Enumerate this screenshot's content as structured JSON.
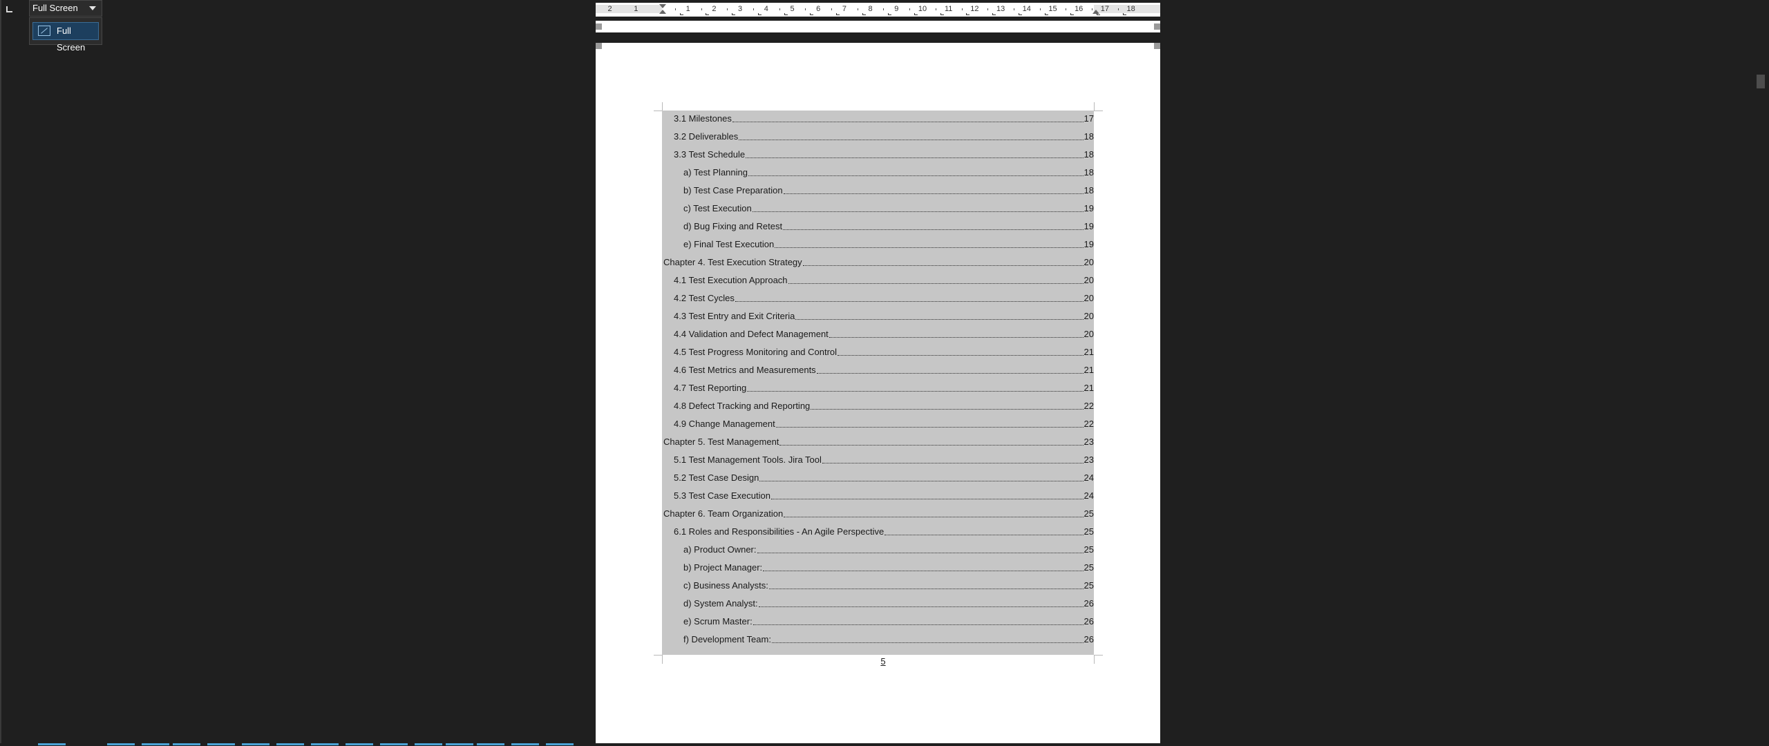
{
  "view_mode": {
    "selected": "Full Screen",
    "menu_items": [
      "Full Screen"
    ]
  },
  "ruler": {
    "left_labels": [
      "2",
      "1"
    ],
    "labels": [
      "1",
      "2",
      "3",
      "4",
      "5",
      "6",
      "7",
      "8",
      "9",
      "10",
      "11",
      "12",
      "13",
      "14",
      "15",
      "16",
      "17",
      "18"
    ]
  },
  "toc": {
    "entries": [
      {
        "text": "3.1 Milestones",
        "page": "17",
        "level": 1
      },
      {
        "text": "3.2 Deliverables",
        "page": "18",
        "level": 1
      },
      {
        "text": "3.3 Test Schedule",
        "page": "18",
        "level": 1
      },
      {
        "text": "a) Test Planning",
        "page": "18",
        "level": 2
      },
      {
        "text": "b) Test Case Preparation",
        "page": "18",
        "level": 2
      },
      {
        "text": "c) Test Execution",
        "page": "19",
        "level": 2
      },
      {
        "text": "d) Bug Fixing and Retest",
        "page": "19",
        "level": 2
      },
      {
        "text": "e) Final Test Execution",
        "page": "19",
        "level": 2
      },
      {
        "text": "Chapter 4. Test Execution Strategy",
        "page": "20",
        "level": 0
      },
      {
        "text": "4.1 Test Execution Approach",
        "page": "20",
        "level": 1
      },
      {
        "text": "4.2 Test Cycles",
        "page": "20",
        "level": 1
      },
      {
        "text": "4.3 Test Entry and Exit Criteria",
        "page": "20",
        "level": 1
      },
      {
        "text": "4.4 Validation and Defect Management",
        "page": "20",
        "level": 1
      },
      {
        "text": "4.5 Test Progress Monitoring and Control",
        "page": "21",
        "level": 1
      },
      {
        "text": "4.6 Test Metrics and Measurements",
        "page": "21",
        "level": 1
      },
      {
        "text": "4.7 Test Reporting",
        "page": "21",
        "level": 1
      },
      {
        "text": "4.8 Defect Tracking and Reporting",
        "page": "22",
        "level": 1
      },
      {
        "text": "4.9 Change Management",
        "page": "22",
        "level": 1
      },
      {
        "text": "Chapter 5. Test Management",
        "page": "23",
        "level": 0
      },
      {
        "text": "5.1 Test Management Tools. Jira Tool",
        "page": "23",
        "level": 1
      },
      {
        "text": "5.2 Test Case Design",
        "page": "24",
        "level": 1
      },
      {
        "text": "5.3 Test Case Execution",
        "page": "24",
        "level": 1
      },
      {
        "text": "Chapter 6. Team Organization",
        "page": "25",
        "level": 0
      },
      {
        "text": "6.1 Roles and Responsibilities - An Agile Perspective",
        "page": "25",
        "level": 1
      },
      {
        "text": "a) Product Owner:",
        "page": "25",
        "level": 2
      },
      {
        "text": "b) Project Manager:",
        "page": "25",
        "level": 2
      },
      {
        "text": "c) Business Analysts:",
        "page": "25",
        "level": 2
      },
      {
        "text": "d) System Analyst:",
        "page": "26",
        "level": 2
      },
      {
        "text": "e) Scrum Master:",
        "page": "26",
        "level": 2
      },
      {
        "text": "f) Development Team:",
        "page": "26",
        "level": 2
      }
    ]
  },
  "page_number": "5",
  "colors": {
    "background": "#1f1f1f",
    "toc_highlight": "#c6c6c6",
    "menu_selection": "#1d3f5e"
  }
}
